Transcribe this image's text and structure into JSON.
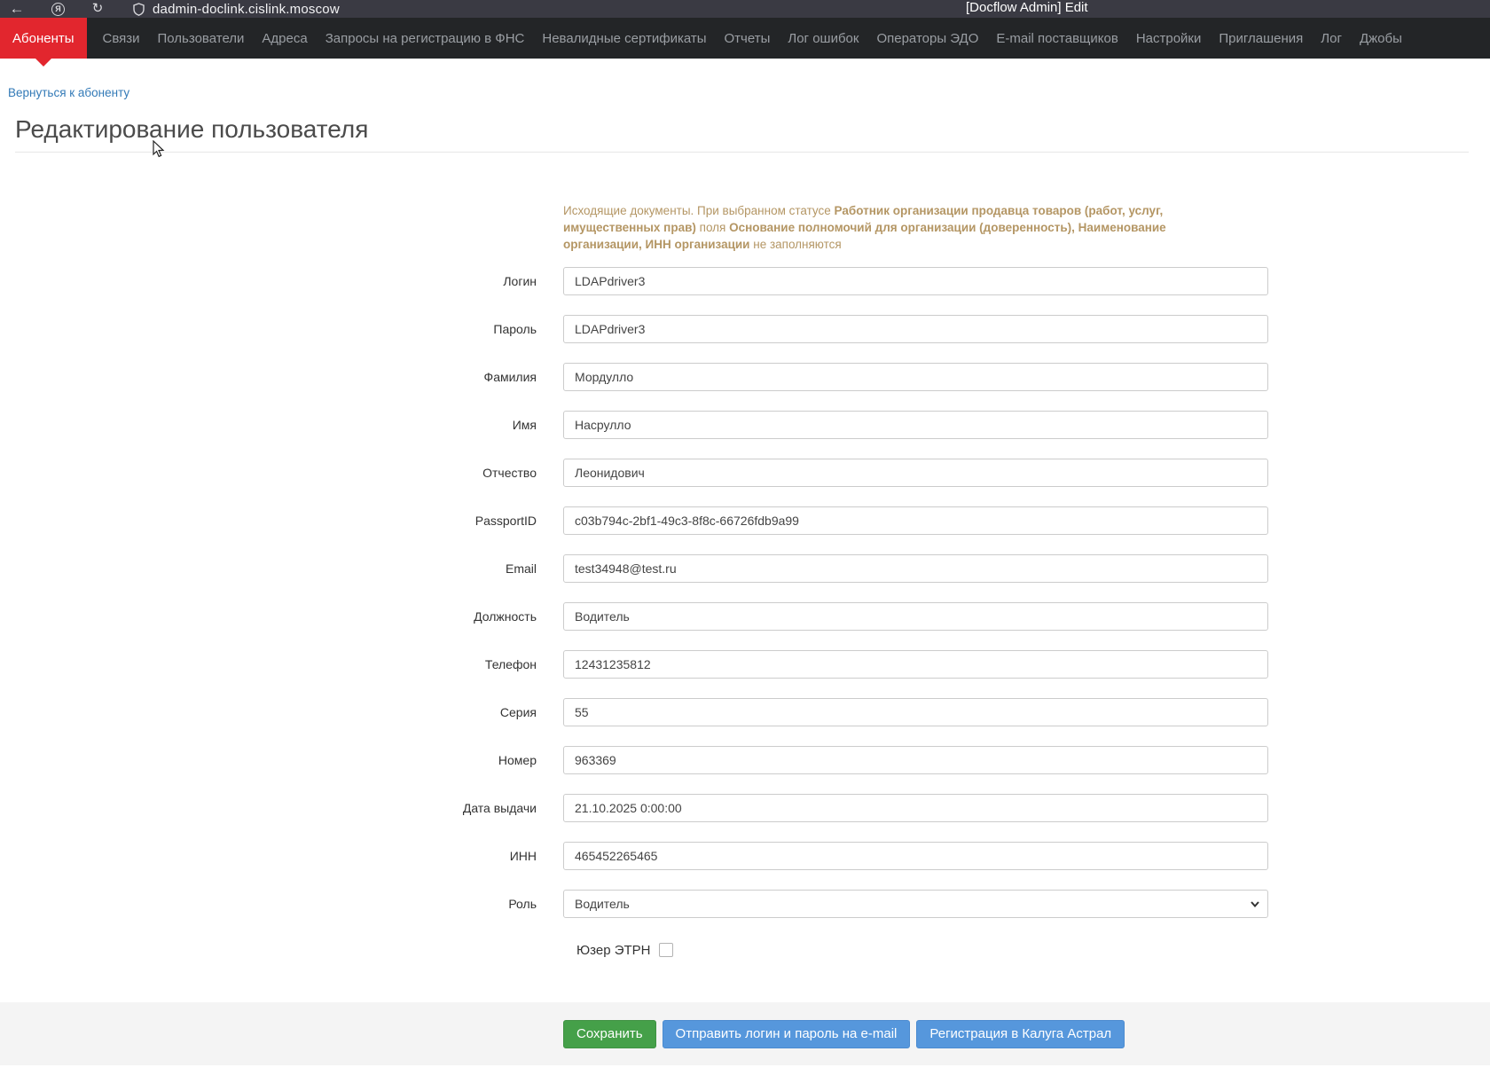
{
  "browser": {
    "url": "dadmin-doclink.cislink.moscow",
    "window_title": "[Docflow Admin] Edit",
    "back_icon": "←",
    "yandex_icon": "Я",
    "reload_icon": "↻"
  },
  "nav": {
    "items": [
      {
        "name": "abonenty",
        "label": "Абоненты",
        "active": true
      },
      {
        "name": "svyazi",
        "label": "Связи",
        "active": false
      },
      {
        "name": "polzovateli",
        "label": "Пользователи",
        "active": false
      },
      {
        "name": "adresa",
        "label": "Адреса",
        "active": false
      },
      {
        "name": "zaprosy-fns",
        "label": "Запросы на регистрацию в ФНС",
        "active": false
      },
      {
        "name": "nevalidnye-sertifikaty",
        "label": "Невалидные сертификаты",
        "active": false
      },
      {
        "name": "otchety",
        "label": "Отчеты",
        "active": false
      },
      {
        "name": "log-oshibok",
        "label": "Лог ошибок",
        "active": false
      },
      {
        "name": "operatory-edo",
        "label": "Операторы ЭДО",
        "active": false
      },
      {
        "name": "email-postavshchikov",
        "label": "E-mail поставщиков",
        "active": false
      },
      {
        "name": "nastroyki",
        "label": "Настройки",
        "active": false
      },
      {
        "name": "priglasheniya",
        "label": "Приглашения",
        "active": false
      },
      {
        "name": "log",
        "label": "Лог",
        "active": false
      },
      {
        "name": "dzhoby",
        "label": "Джобы",
        "active": false
      }
    ]
  },
  "page": {
    "back_link": "Вернуться к абоненту",
    "title": "Редактирование пользователя"
  },
  "warning": {
    "segments": [
      {
        "text": "Исходящие документы. При выбранном статусе ",
        "bold": false
      },
      {
        "text": "Работник организации продавца товаров (работ, услуг, имущественных прав)",
        "bold": true
      },
      {
        "text": " поля ",
        "bold": false
      },
      {
        "text": "Основание полномочий для организации (доверенность), Наименование организации, ИНН организации",
        "bold": true
      },
      {
        "text": " не заполняются",
        "bold": false
      }
    ]
  },
  "form": {
    "fields": [
      {
        "name": "login",
        "label": "Логин",
        "value": "LDAPdriver3",
        "type": "text"
      },
      {
        "name": "password",
        "label": "Пароль",
        "value": "LDAPdriver3",
        "type": "text"
      },
      {
        "name": "surname",
        "label": "Фамилия",
        "value": "Мордулло",
        "type": "text"
      },
      {
        "name": "firstname",
        "label": "Имя",
        "value": "Насрулло",
        "type": "text"
      },
      {
        "name": "patronymic",
        "label": "Отчество",
        "value": "Леонидович",
        "type": "text"
      },
      {
        "name": "passport-id",
        "label": "PassportID",
        "value": "c03b794c-2bf1-49c3-8f8c-66726fdb9a99",
        "type": "text"
      },
      {
        "name": "email",
        "label": "Email",
        "value": "test34948@test.ru",
        "type": "text"
      },
      {
        "name": "position",
        "label": "Должность",
        "value": "Водитель",
        "type": "text"
      },
      {
        "name": "phone",
        "label": "Телефон",
        "value": "12431235812",
        "type": "text"
      },
      {
        "name": "series",
        "label": "Серия",
        "value": "55",
        "type": "text"
      },
      {
        "name": "number",
        "label": "Номер",
        "value": "963369",
        "type": "text"
      },
      {
        "name": "issue-date",
        "label": "Дата выдачи",
        "value": "21.10.2025 0:00:00",
        "type": "text"
      },
      {
        "name": "inn",
        "label": "ИНН",
        "value": "465452265465",
        "type": "text"
      },
      {
        "name": "role",
        "label": "Роль",
        "value": "Водитель",
        "type": "select"
      }
    ],
    "checkbox": {
      "label": "Юзер ЭТРН",
      "checked": false
    }
  },
  "footer": {
    "buttons": [
      {
        "name": "save",
        "label": "Сохранить",
        "style": "success"
      },
      {
        "name": "send-credentials",
        "label": "Отправить логин и пароль на e-mail",
        "style": "primary"
      },
      {
        "name": "kaluga-astral-registration",
        "label": "Регистрация в Калуга Астрал",
        "style": "primary"
      }
    ]
  },
  "colors": {
    "nav_bg": "#232527",
    "chrome_bg": "#3a3a43",
    "accent_red": "#e2262e",
    "link_blue": "#337ab7",
    "warning_text": "#b49664",
    "save_green": "#45a049",
    "action_blue": "#5697dc",
    "footer_bg": "#f4f4f4"
  }
}
